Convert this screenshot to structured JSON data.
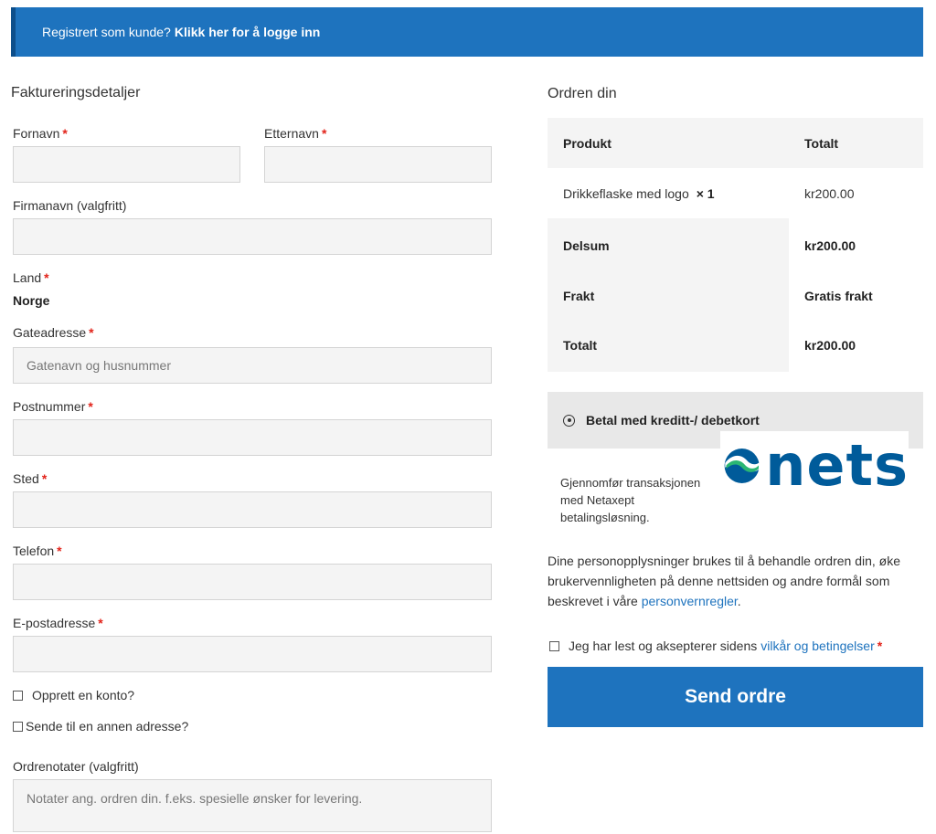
{
  "notice": {
    "text": "Registrert som kunde?",
    "link": "Klikk her for å logge inn"
  },
  "billing": {
    "title": "Faktureringsdetaljer",
    "first_name": {
      "label": "Fornavn",
      "value": ""
    },
    "last_name": {
      "label": "Etternavn",
      "value": ""
    },
    "company": {
      "label": "Firmanavn (valgfritt)",
      "value": ""
    },
    "country": {
      "label": "Land",
      "value": "Norge"
    },
    "street": {
      "label": "Gateadresse",
      "placeholder": "Gatenavn og husnummer"
    },
    "postcode": {
      "label": "Postnummer",
      "value": ""
    },
    "city": {
      "label": "Sted",
      "value": ""
    },
    "phone": {
      "label": "Telefon",
      "value": ""
    },
    "email": {
      "label": "E-postadresse",
      "value": ""
    },
    "create_account": "Opprett en konto?",
    "ship_different": "Sende til en annen adresse?",
    "notes": {
      "label": "Ordrenotater (valgfritt)",
      "placeholder": "Notater ang. ordren din. f.eks. spesielle ønsker for levering."
    },
    "required_mark": "*"
  },
  "order": {
    "title": "Ordren din",
    "head_product": "Produkt",
    "head_total": "Totalt",
    "item_name": "Drikkeflaske med logo",
    "item_qty": "× 1",
    "item_price": "kr200.00",
    "subtotal_label": "Delsum",
    "subtotal_value": "kr200.00",
    "shipping_label": "Frakt",
    "shipping_value": "Gratis frakt",
    "total_label": "Totalt",
    "total_value": "kr200.00"
  },
  "payment": {
    "method_label": "Betal med kreditt-/ debetkort",
    "logo_text": "nets",
    "description": "Gjennomfør transaksjonen med Netaxept betalingsløsning."
  },
  "privacy": {
    "text": "Dine personopplysninger brukes til å behandle ordren din, øke brukervennligheten på denne nettsiden og andre formål som beskrevet i våre",
    "link": "personvernregler",
    "end": "."
  },
  "terms": {
    "text": "Jeg har lest og aksepterer sidens",
    "link": "vilkår og betingelser",
    "required": "*"
  },
  "submit_label": "Send ordre",
  "colors": {
    "accent": "#1e73be",
    "required": "#e2231a",
    "nets_green": "#2bb673",
    "nets_blue": "#005b9a"
  }
}
